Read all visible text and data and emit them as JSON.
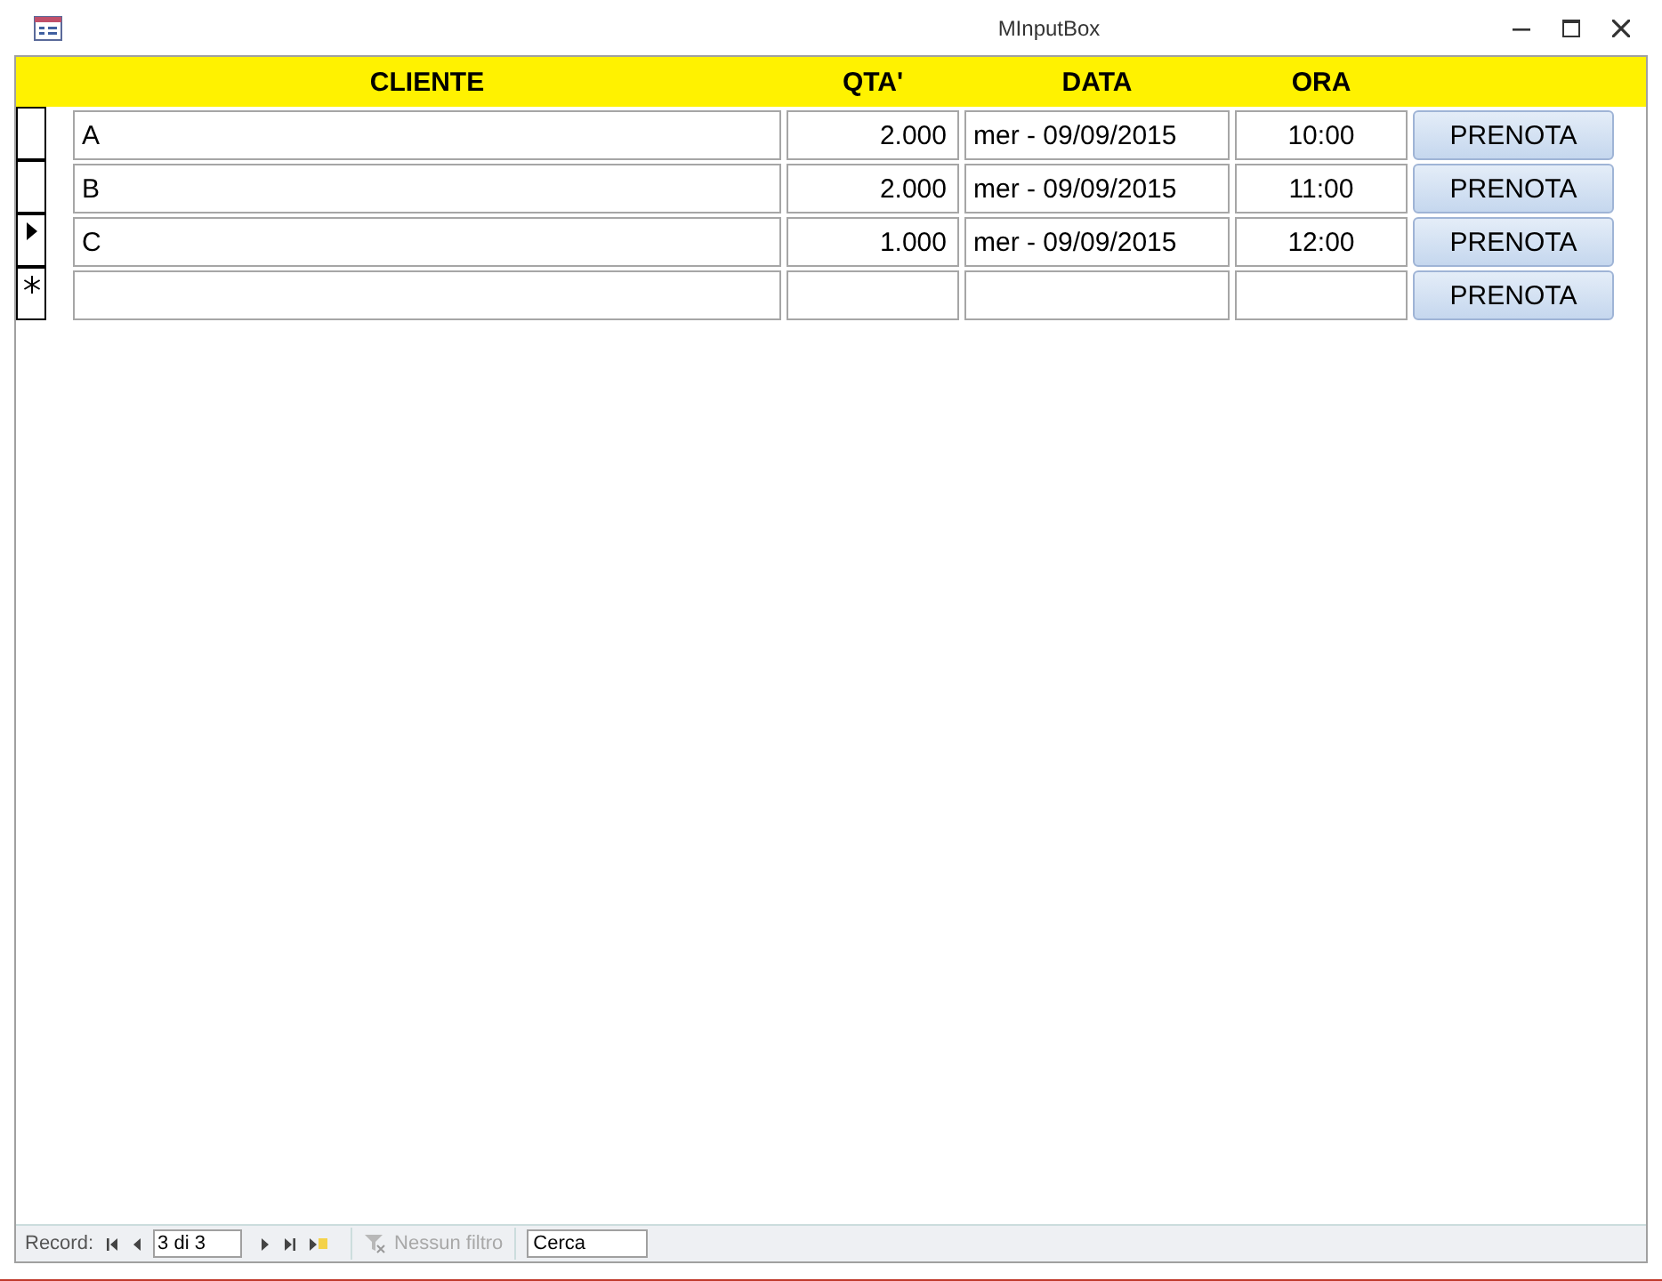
{
  "window": {
    "title": "MInputBox"
  },
  "header": {
    "columns": [
      "CLIENTE",
      "QTA'",
      "DATA",
      "ORA"
    ]
  },
  "rows": [
    {
      "kind": "record",
      "cliente": "A",
      "qta": "2.000",
      "data": "mer - 09/09/2015",
      "ora": "10:00",
      "button": "PRENOTA"
    },
    {
      "kind": "record",
      "cliente": "B",
      "qta": "2.000",
      "data": "mer - 09/09/2015",
      "ora": "11:00",
      "button": "PRENOTA"
    },
    {
      "kind": "current",
      "cliente": "C",
      "qta": "1.000",
      "data": "mer - 09/09/2015",
      "ora": "12:00",
      "button": "PRENOTA"
    },
    {
      "kind": "new",
      "cliente": "",
      "qta": "",
      "data": "",
      "ora": "",
      "button": "PRENOTA"
    }
  ],
  "status_bar": {
    "label": "Record:",
    "position": "3 di 3",
    "filter": {
      "label": "Nessun filtro",
      "disabled": true
    },
    "search": {
      "placeholder": "Cerca"
    }
  }
}
